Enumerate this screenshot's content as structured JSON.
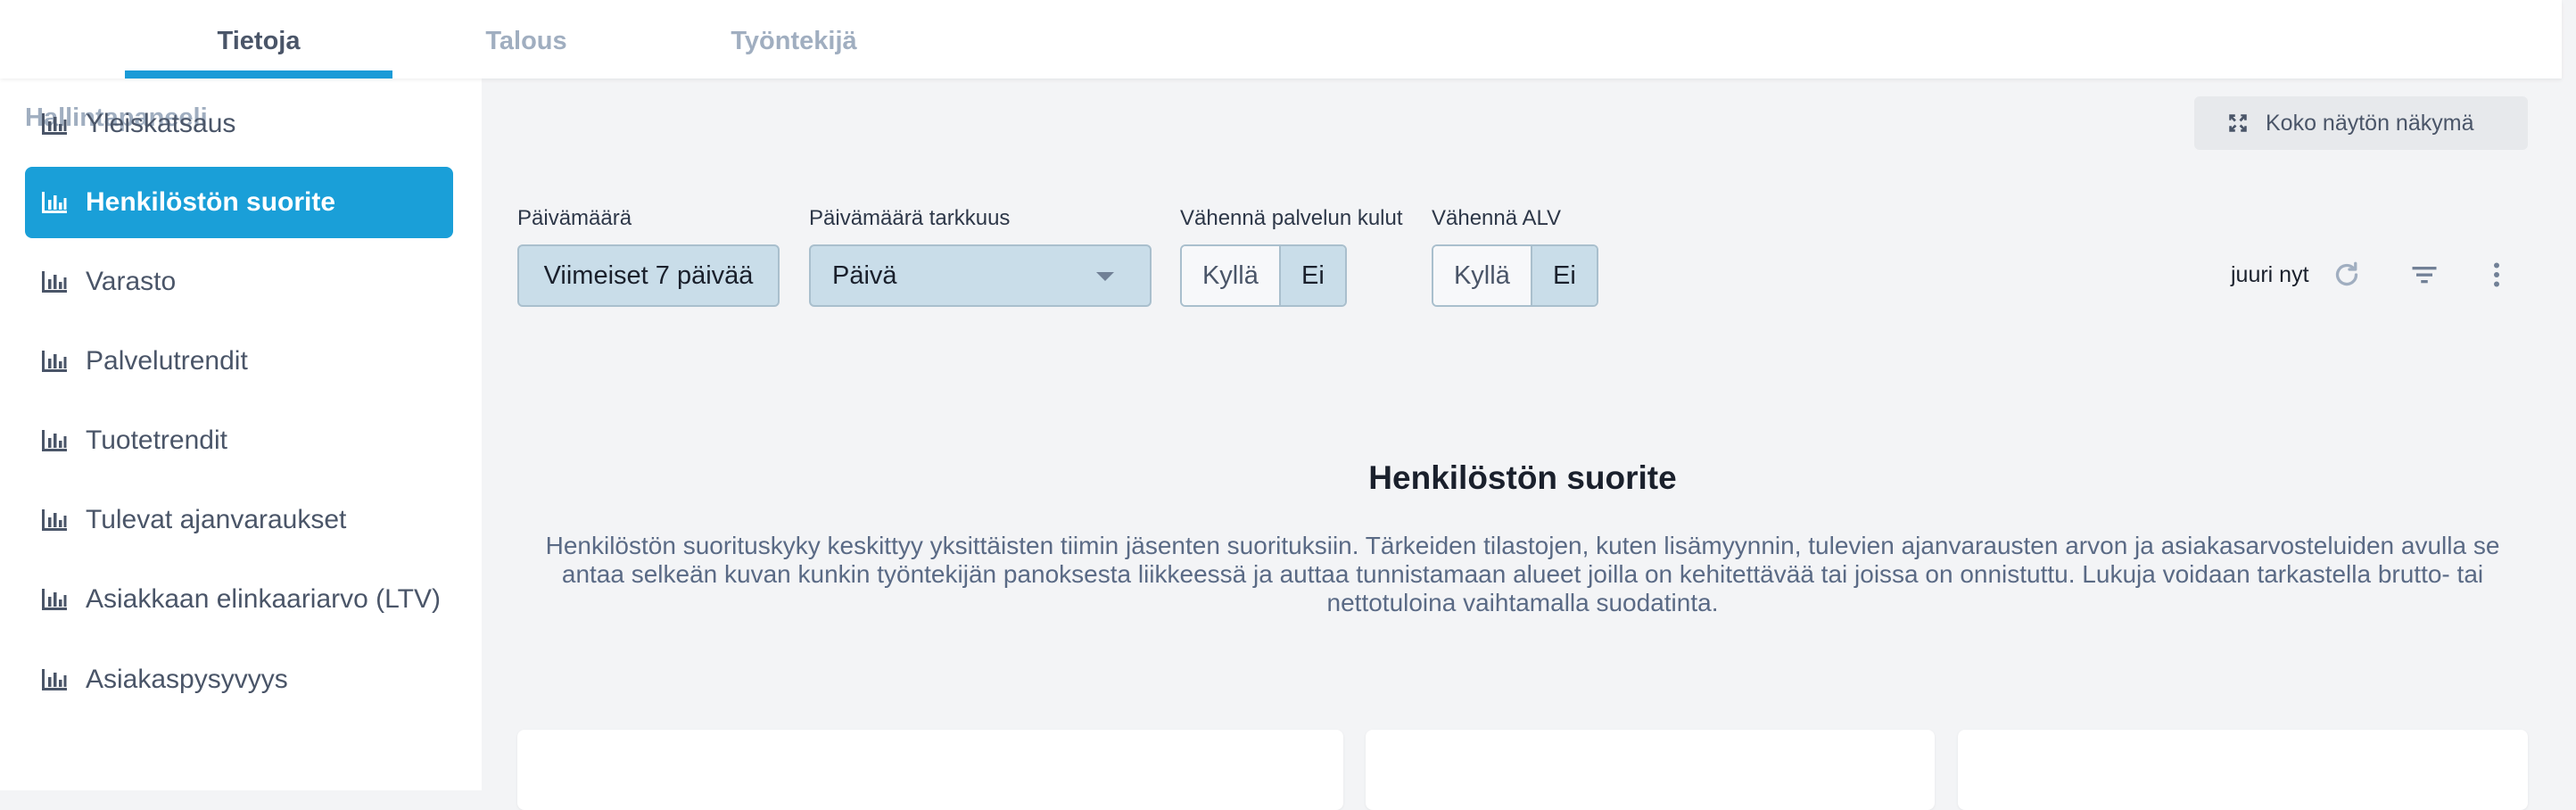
{
  "tabs": [
    {
      "label": "Tietoja",
      "active": true
    },
    {
      "label": "Talous",
      "active": false
    },
    {
      "label": "Työntekijä",
      "active": false
    }
  ],
  "sidebar": {
    "title": "Hallintapaneeli",
    "items": [
      {
        "label": "Yleiskatsaus",
        "icon": "bar-chart-icon"
      },
      {
        "label": "Henkilöstön suorite",
        "icon": "bar-chart-icon",
        "active": true
      },
      {
        "label": "Varasto",
        "icon": "bar-chart-icon"
      },
      {
        "label": "Palvelutrendit",
        "icon": "bar-chart-icon"
      },
      {
        "label": "Tuotetrendit",
        "icon": "bar-chart-icon"
      },
      {
        "label": "Tulevat ajanvaraukset",
        "icon": "bar-chart-icon"
      },
      {
        "label": "Asiakkaan elinkaariarvo (LTV)",
        "icon": "bar-chart-icon"
      },
      {
        "label": "Asiakaspysyvyys",
        "icon": "bar-chart-icon"
      }
    ]
  },
  "toolbar": {
    "fullscreen_label": "Koko näytön näkymä",
    "updated_label": "juuri nyt"
  },
  "filters": {
    "date": {
      "label": "Päivämäärä",
      "value": "Viimeiset 7 päivää"
    },
    "precision": {
      "label": "Päivämäärä tarkkuus",
      "value": "Päivä"
    },
    "service_costs": {
      "label": "Vähennä palvelun kulut",
      "yes": "Kyllä",
      "no": "Ei",
      "selected": "Ei"
    },
    "vat": {
      "label": "Vähennä ALV",
      "yes": "Kyllä",
      "no": "Ei",
      "selected": "Ei"
    }
  },
  "content": {
    "title": "Henkilöstön suorite",
    "description": "Henkilöstön suorituskyky keskittyy yksittäisten tiimin jäsenten suorituksiin. Tärkeiden tilastojen, kuten lisämyynnin, tulevien ajanvarausten arvon ja asiakasarvosteluiden avulla se antaa selkeän kuvan kunkin työntekijän panoksesta liikkeessä ja auttaa tunnistamaan alueet joilla on kehitettävää tai joissa on onnistuttu. Lukuja voidaan tarkastella brutto- tai nettotuloina vaihtamalla suodatinta."
  },
  "colors": {
    "accent": "#1a9fd8",
    "selected_control": "#c9dde9"
  }
}
